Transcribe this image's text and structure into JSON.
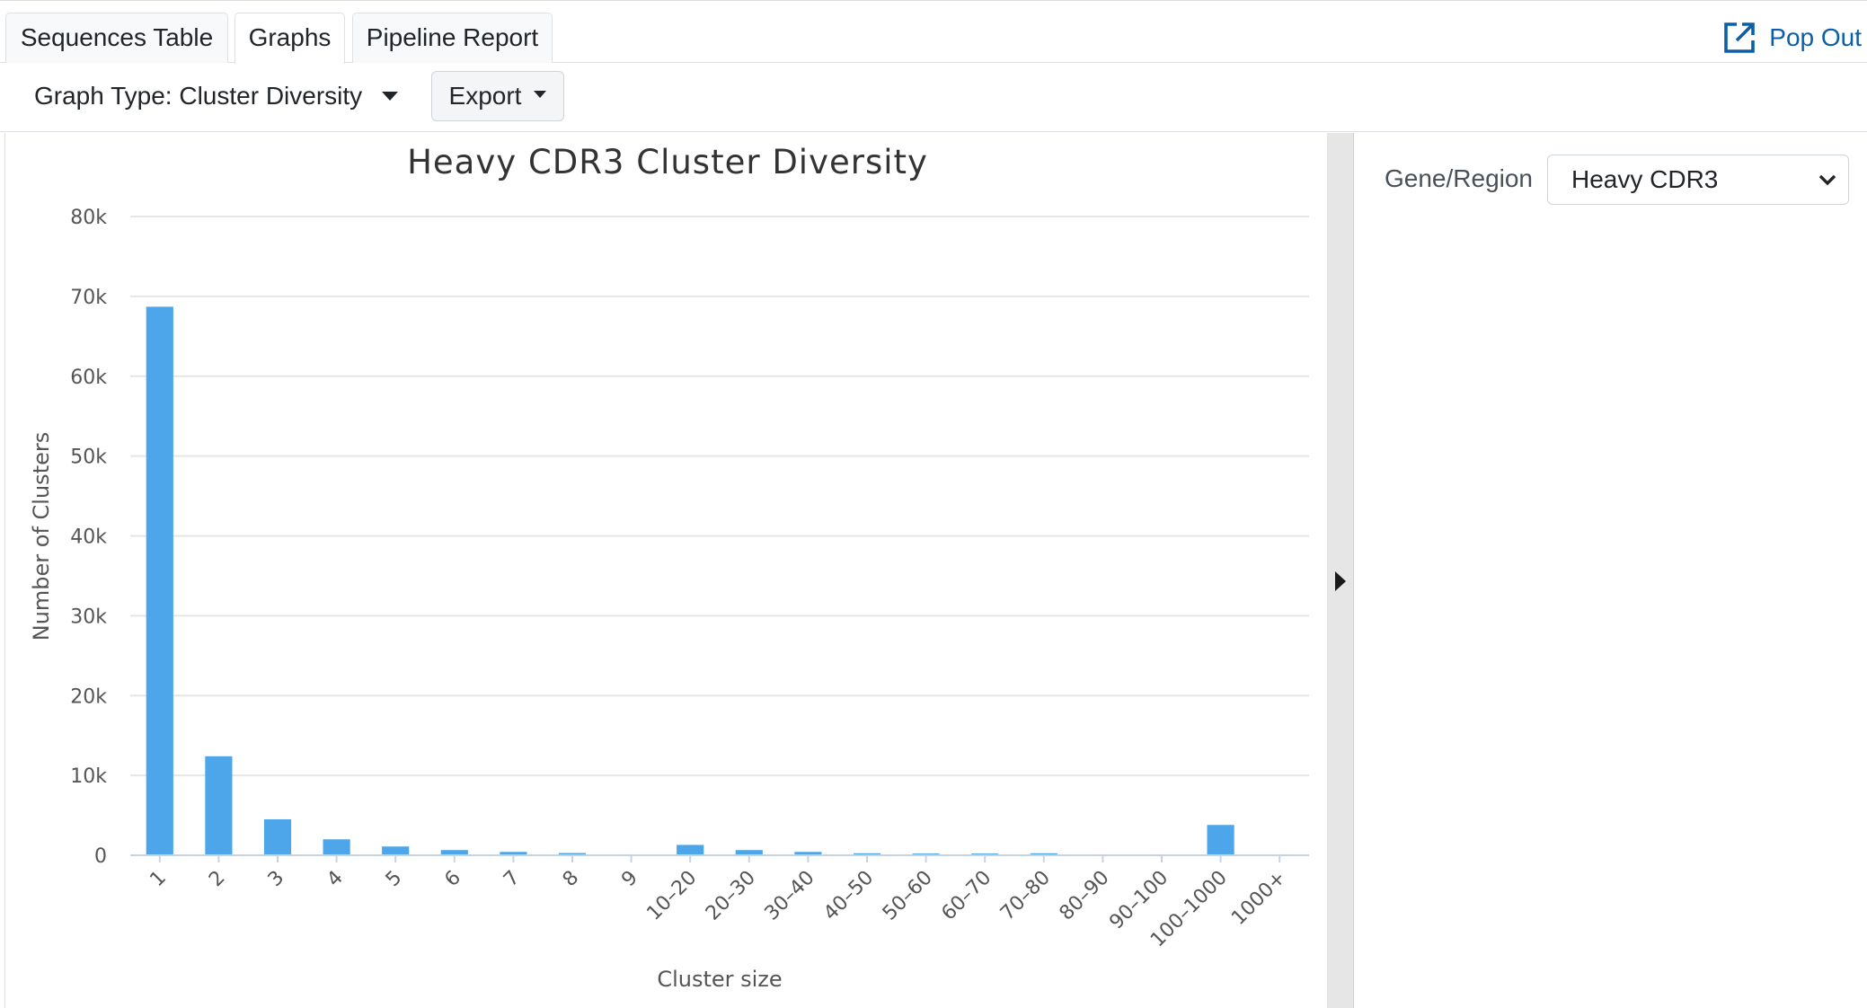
{
  "tabs": [
    {
      "label": "Sequences Table",
      "active": false
    },
    {
      "label": "Graphs",
      "active": true
    },
    {
      "label": "Pipeline Report",
      "active": false
    }
  ],
  "pop_out": {
    "label": "Pop Out",
    "icon": "external-link-icon"
  },
  "toolbar": {
    "graph_type_label": "Graph Type: Cluster Diversity",
    "export_label": "Export"
  },
  "side_panel": {
    "gene_region_label": "Gene/Region",
    "gene_region_value": "Heavy CDR3"
  },
  "colors": {
    "bar": "#4ea6ea",
    "link": "#0b5ea8",
    "grid": "#e6e6e6"
  },
  "chart_data": {
    "type": "bar",
    "title": "Heavy CDR3 Cluster Diversity",
    "xlabel": "Cluster size",
    "ylabel": "Number of Clusters",
    "ylim": [
      0,
      80000
    ],
    "yticks": [
      0,
      10000,
      20000,
      30000,
      40000,
      50000,
      60000,
      70000,
      80000
    ],
    "ytick_labels": [
      "0",
      "10k",
      "20k",
      "30k",
      "40k",
      "50k",
      "60k",
      "70k",
      "80k"
    ],
    "grid": true,
    "legend": false,
    "categories": [
      "1",
      "2",
      "3",
      "4",
      "5",
      "6",
      "7",
      "8",
      "9",
      "10–20",
      "20–30",
      "30–40",
      "40–50",
      "50–60",
      "60–70",
      "70–80",
      "80–90",
      "90–100",
      "100–1000",
      "1000+"
    ],
    "values": [
      68700,
      12400,
      4500,
      2000,
      1100,
      650,
      420,
      280,
      0,
      1300,
      650,
      420,
      250,
      220,
      220,
      250,
      0,
      0,
      3800,
      0
    ]
  }
}
